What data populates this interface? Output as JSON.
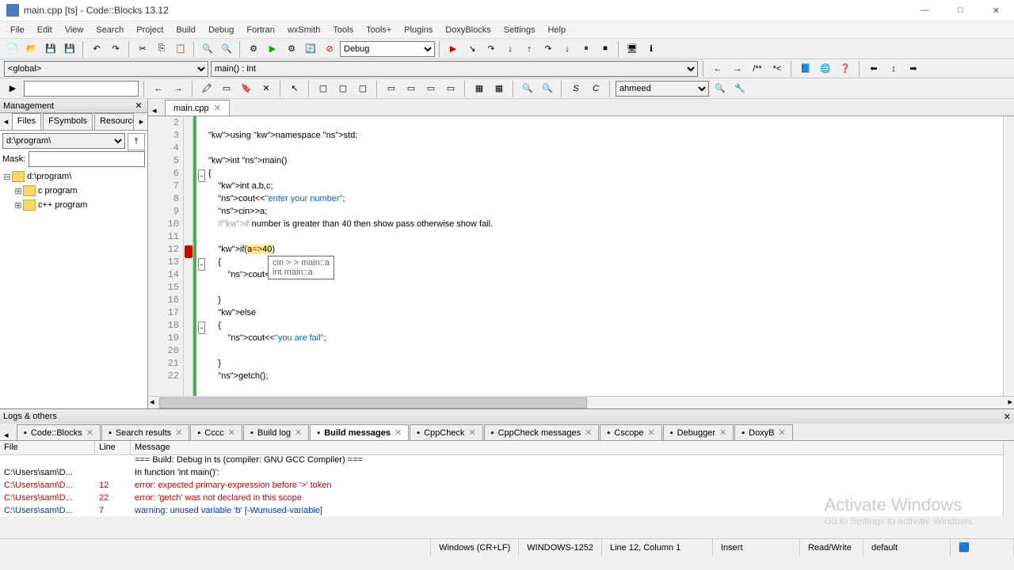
{
  "window": {
    "title": "main.cpp [ts] - Code::Blocks 13.12"
  },
  "menu": [
    "File",
    "Edit",
    "View",
    "Search",
    "Project",
    "Build",
    "Debug",
    "Fortran",
    "wxSmith",
    "Tools",
    "Tools+",
    "Plugins",
    "DoxyBlocks",
    "Settings",
    "Help"
  ],
  "build_target": "Debug",
  "scope": {
    "global": "<global>",
    "func": "main() : int"
  },
  "search_name": "ahmeed",
  "management": {
    "title": "Management",
    "tabs": [
      "Files",
      "FSymbols",
      "Resources"
    ],
    "path": "d:\\program\\",
    "mask_label": "Mask:",
    "tree": [
      "d:\\program\\",
      "c program",
      "c++ program"
    ]
  },
  "editor": {
    "tab": "main.cpp",
    "first_line_no": 2,
    "lines": [
      "",
      "using namespace std;",
      "",
      "int main()",
      "{",
      "    int a,b,c;",
      "    cout<<\"enter your number\";",
      "    cin>>a;",
      "    //if number is greater than 40 then show pass otherwise show fail.",
      "",
      "    if(a=>40)",
      "    {",
      "        cout<<\"you are pass\";",
      "",
      "    }",
      "    else",
      "    {",
      "        cout<<\"you are fail\";",
      "",
      "    }",
      "    getch();"
    ],
    "tooltip": {
      "line1": "cin > > main::a",
      "line2": "int main::a"
    }
  },
  "logs": {
    "title": "Logs & others",
    "tabs": [
      "Code::Blocks",
      "Search results",
      "Cccc",
      "Build log",
      "Build messages",
      "CppCheck",
      "CppCheck messages",
      "Cscope",
      "Debugger",
      "DoxyB"
    ],
    "active_tab": 4,
    "columns": [
      "File",
      "Line",
      "Message"
    ],
    "rows": [
      {
        "file": "",
        "line": "",
        "msg": "=== Build: Debug in ts (compiler: GNU GCC Compiler) ===",
        "cls": ""
      },
      {
        "file": "C:\\Users\\sam\\D...",
        "line": "",
        "msg": "In function 'int main()':",
        "cls": ""
      },
      {
        "file": "C:\\Users\\sam\\D...",
        "line": "12",
        "msg": "error: expected primary-expression before '>' token",
        "cls": "err"
      },
      {
        "file": "C:\\Users\\sam\\D...",
        "line": "22",
        "msg": "error: 'getch' was not declared in this scope",
        "cls": "err"
      },
      {
        "file": "C:\\Users\\sam\\D...",
        "line": "7",
        "msg": "warning: unused variable 'b' [-Wunused-variable]",
        "cls": "info"
      }
    ]
  },
  "status": {
    "eol": "Windows (CR+LF)",
    "encoding": "WINDOWS-1252",
    "pos": "Line 12, Column 1",
    "mode": "Insert",
    "rw": "Read/Write",
    "profile": "default"
  },
  "watermark": {
    "big": "Activate Windows",
    "small": "Go to Settings to activate Windows."
  }
}
